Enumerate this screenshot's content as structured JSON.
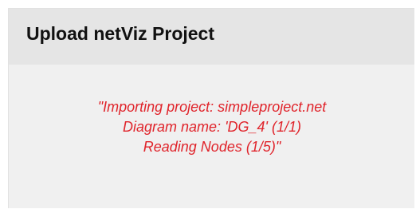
{
  "panel": {
    "title": "Upload netViz Project"
  },
  "status": {
    "lines": [
      "\"Importing project: simpleproject.net",
      "Diagram name: 'DG_4' (1/1)",
      "Reading Nodes (1/5)\""
    ]
  },
  "colors": {
    "status_text": "#e0242b",
    "header_background": "#e5e5e5",
    "panel_background": "#f0f0f0"
  }
}
